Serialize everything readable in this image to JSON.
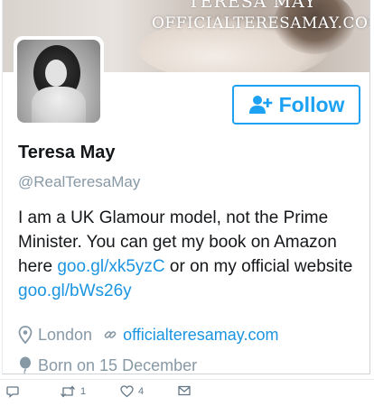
{
  "banner": {
    "top_text": "TERESA MAY",
    "site_text": "OFFICIALTERESAMAY.COM"
  },
  "profile": {
    "name": "Teresa May",
    "handle": "@RealTeresaMay",
    "follow_label": "Follow",
    "bio": {
      "part1": "I am a UK Glamour model, not the Prime Minister. You can get my book on Amazon here ",
      "link1": "goo.gl/xk5yzC",
      "part2": " or on my official website ",
      "link2": "goo.gl/bWs26y"
    },
    "location": "London",
    "website": "officialteresamay.com",
    "birthday": "Born on 15 December"
  },
  "actions": {
    "retweets": "1",
    "likes": "4"
  },
  "icons": {
    "follow": "add-user-icon",
    "location": "location-pin-icon",
    "website": "link-icon",
    "birthday": "balloon-icon",
    "reply": "reply-icon",
    "retweet": "retweet-icon",
    "like": "heart-icon",
    "message": "envelope-icon"
  },
  "colors": {
    "accent": "#1da1f2",
    "link": "#1b95e0",
    "muted": "#8899a6"
  }
}
